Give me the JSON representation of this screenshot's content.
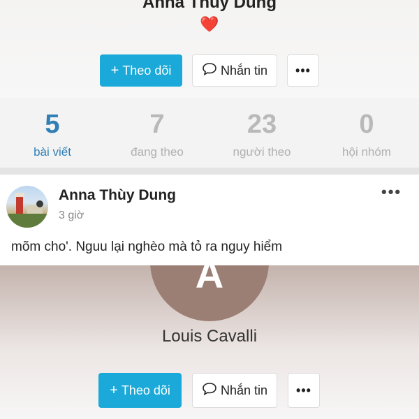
{
  "top_profile": {
    "name": "Anna Thùy Dung",
    "heart": "❤️",
    "follow_label": "Theo dõi",
    "message_label": "Nhắn tin",
    "more_label": "•••"
  },
  "stats": [
    {
      "value": "5",
      "label": "bài viết",
      "active": true
    },
    {
      "value": "7",
      "label": "đang theo",
      "active": false
    },
    {
      "value": "23",
      "label": "người theo",
      "active": false
    },
    {
      "value": "0",
      "label": "hội nhóm",
      "active": false
    }
  ],
  "post": {
    "author": "Anna Thùy Dung",
    "time": "3 giờ",
    "more_label": "•••",
    "text": "mõm cho'. Nguu lại nghèo mà tỏ ra nguy hiểm"
  },
  "bottom_profile": {
    "avatar_letter": "A",
    "name": "Louis Cavalli",
    "follow_label": "Theo dõi",
    "message_label": "Nhắn tin",
    "more_label": "•••"
  },
  "colors": {
    "accent": "#1aa9d8",
    "active_stat": "#2f7fb5",
    "avatar_bg": "#9c7f74"
  }
}
